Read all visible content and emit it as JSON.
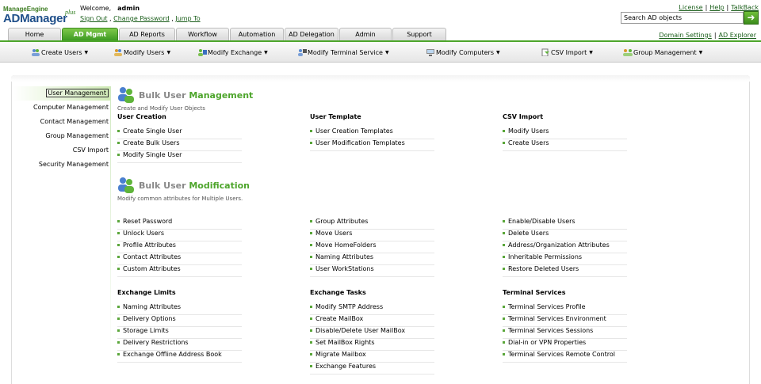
{
  "logo": {
    "top": "ManageEngine",
    "main": "ADManager",
    "sup": "plus"
  },
  "welcome": {
    "label": "Welcome,",
    "user": "admin"
  },
  "user_links": [
    "Sign Out",
    "Change Password",
    "Jump To"
  ],
  "top_links": [
    "License",
    "Help",
    "TalkBack"
  ],
  "search": {
    "value": "Search AD objects"
  },
  "tabs": [
    "Home",
    "AD Mgmt",
    "AD Reports",
    "Workflow",
    "Automation",
    "AD Delegation",
    "Admin",
    "Support"
  ],
  "active_tab": "AD Mgmt",
  "right_links": [
    "Domain Settings",
    "AD Explorer"
  ],
  "submenu": [
    "Create Users",
    "Modify Users",
    "Modify Exchange",
    "Modify Terminal Service",
    "Modify Computers",
    "CSV Import",
    "Group Management"
  ],
  "left_nav": [
    "User Management",
    "Computer Management",
    "Contact Management",
    "Group Management",
    "CSV Import",
    "Security Management"
  ],
  "bulk_user_mgmt": {
    "title_a": "Bulk User",
    "title_b": "Management",
    "subtitle": "Create and Modify User Objects",
    "user_creation": {
      "head": "User Creation",
      "links": [
        "Create Single User",
        "Create Bulk Users",
        "Modify Single User"
      ]
    },
    "user_template": {
      "head": "User Template",
      "links": [
        "User Creation Templates",
        "User Modification Templates"
      ]
    },
    "csv_import": {
      "head": "CSV Import",
      "links": [
        "Modify Users",
        "Create Users"
      ]
    }
  },
  "bulk_user_mod": {
    "title_a": "Bulk User",
    "title_b": "Modification",
    "subtitle": "Modify common attributes for Multiple Users.",
    "col1": [
      "Reset Password",
      "Unlock Users",
      "Profile Attributes",
      "Contact Attributes",
      "Custom Attributes"
    ],
    "col2": [
      "Group Attributes",
      "Move Users",
      "Move HomeFolders",
      "Naming Attributes",
      "User WorkStations"
    ],
    "col3": [
      "Enable/Disable Users",
      "Delete Users",
      "Address/Organization Attributes",
      "Inheritable Permissions",
      "Restore Deleted Users"
    ]
  },
  "exchange_limits": {
    "head": "Exchange Limits",
    "links": [
      "Naming Attributes",
      "Delivery Options",
      "Storage Limits",
      "Delivery Restrictions",
      "Exchange Offline Address Book"
    ]
  },
  "exchange_tasks": {
    "head": "Exchange Tasks",
    "links": [
      "Modify SMTP Address",
      "Create MailBox",
      "Disable/Delete User MailBox",
      "Set MailBox Rights",
      "Migrate Mailbox",
      "Exchange Features"
    ]
  },
  "terminal_services": {
    "head": "Terminal Services",
    "links": [
      "Terminal Services Profile",
      "Terminal Services Environment",
      "Terminal Services Sessions",
      "Dial-in or VPN Properties",
      "Terminal Services Remote Control"
    ]
  },
  "colors": {
    "accent": "#4da52b",
    "link": "#1a5e1a",
    "title_gray": "#888888"
  }
}
